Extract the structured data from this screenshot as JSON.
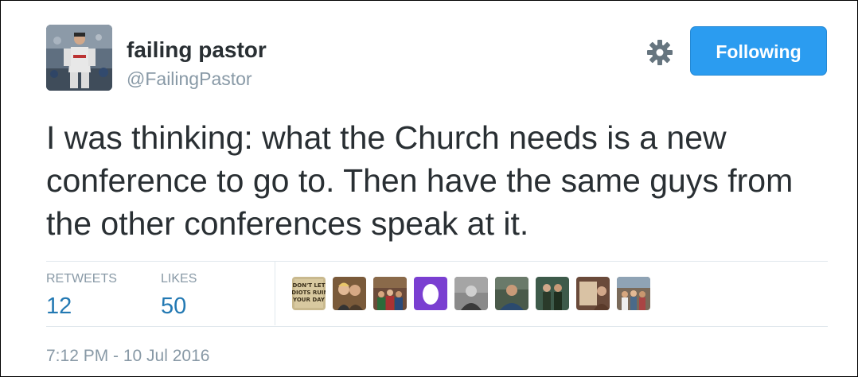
{
  "user": {
    "display_name": "failing pastor",
    "screen_name": "@FailingPastor"
  },
  "actions": {
    "follow_label": "Following",
    "settings_icon": "gear-icon"
  },
  "tweet": {
    "text": "I was thinking: what the Church needs is a new conference to go to. Then have the same guys from the other conferences speak at it."
  },
  "stats": {
    "retweets_label": "RETWEETS",
    "retweets_count": "12",
    "likes_label": "LIKES",
    "likes_count": "50"
  },
  "likers": [
    {
      "name": "liker-avatar-1",
      "poster_text": "DON'T LET IDIOTS RUIN YOUR DAY",
      "color": "#c9b98e"
    },
    {
      "name": "liker-avatar-2",
      "color": "#7a5a3a"
    },
    {
      "name": "liker-avatar-3",
      "color": "#6b4b3a"
    },
    {
      "name": "liker-avatar-4",
      "color": "#7a3fd1"
    },
    {
      "name": "liker-avatar-5",
      "color": "#8a8a8a"
    },
    {
      "name": "liker-avatar-6",
      "color": "#4a5a4a"
    },
    {
      "name": "liker-avatar-7",
      "color": "#3d5a4a"
    },
    {
      "name": "liker-avatar-8",
      "color": "#6a4a3a"
    },
    {
      "name": "liker-avatar-9",
      "color": "#7a6a5a"
    }
  ],
  "timestamp": "7:12 PM - 10 Jul 2016",
  "colors": {
    "follow_button": "#2b9cf0",
    "stat_value": "#2379b3",
    "muted": "#8899a6",
    "text": "#292f33"
  }
}
